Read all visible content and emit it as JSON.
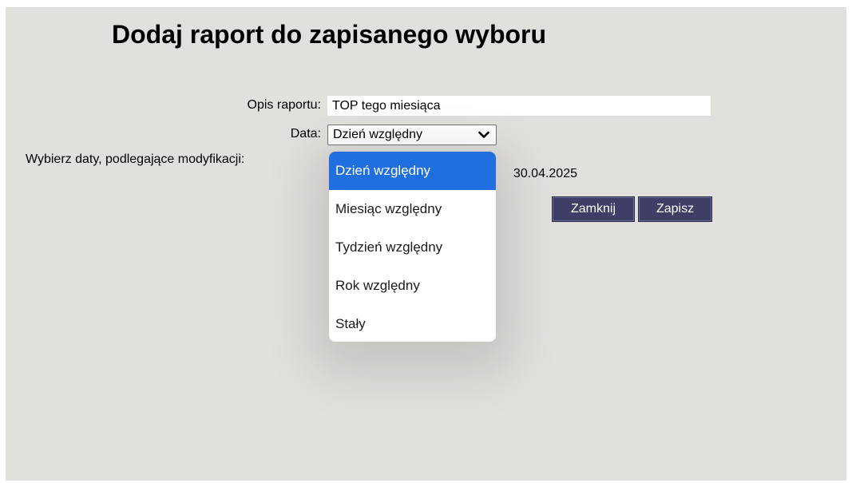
{
  "dialog": {
    "title": "Dodaj raport do zapisanego wyboru",
    "background_color": "#e1e0dd"
  },
  "form": {
    "description_label": "Opis raportu:",
    "description_value": "TOP tego miesiąca",
    "date_label": "Data:",
    "date_selected": "Dzień względny",
    "modify_dates_label": "Wybierz daty, podlegające modyfikacji:",
    "partial_date_text": "30.04.2025"
  },
  "dropdown": {
    "options": [
      {
        "label": "Dzień względny",
        "selected": true
      },
      {
        "label": "Miesiąc względny",
        "selected": false
      },
      {
        "label": "Tydzień względny",
        "selected": false
      },
      {
        "label": "Rok względny",
        "selected": false
      },
      {
        "label": "Stały",
        "selected": false
      }
    ],
    "highlight_color": "#1f6fe0"
  },
  "buttons": {
    "close_label": "Zamknij",
    "save_label": "Zapisz",
    "color": "#3e3e66"
  },
  "icons": {
    "select_arrow": "chevron-down-icon"
  }
}
